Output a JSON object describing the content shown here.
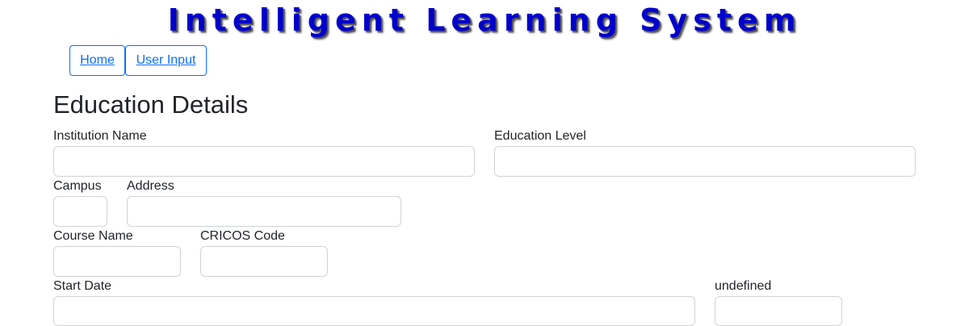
{
  "header": {
    "title": "Intelligent Learning System"
  },
  "nav": {
    "home": "Home",
    "user_input": "User Input"
  },
  "form": {
    "heading": "Education Details",
    "fields": {
      "institution_name": {
        "label": "Institution Name",
        "value": ""
      },
      "education_level": {
        "label": "Education Level",
        "value": ""
      },
      "campus": {
        "label": "Campus",
        "value": ""
      },
      "address": {
        "label": "Address",
        "value": ""
      },
      "course_name": {
        "label": "Course Name",
        "value": ""
      },
      "cricos_code": {
        "label": "CRICOS Code",
        "value": ""
      },
      "start_date": {
        "label": "Start Date",
        "value": ""
      },
      "undefined_field": {
        "label": "undefined",
        "value": ""
      }
    }
  },
  "colors": {
    "title": "#0000cc",
    "link": "#0d6efd",
    "input_border": "#ced4da"
  }
}
